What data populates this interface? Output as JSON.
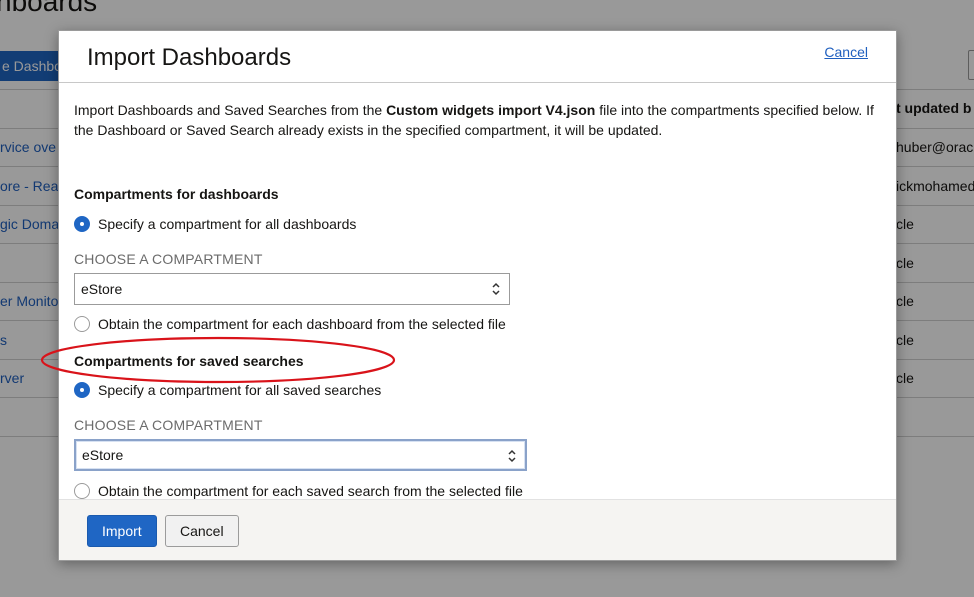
{
  "background": {
    "title_fragment": "hboards",
    "pill_fragment": "e Dashboards",
    "column_head_fragment": "t updated b",
    "left_links": [
      "rvice ove",
      "ore - Real",
      "gic Domai",
      "",
      "er Monito",
      "s",
      "rver"
    ],
    "right_cells": [
      "huber@oracl",
      "ickmohamed",
      "cle",
      "cle",
      "cle",
      "cle",
      "cle"
    ]
  },
  "dialog": {
    "title": "Import Dashboards",
    "cancel_link": "Cancel",
    "intro": {
      "before": "Import Dashboards and Saved Searches from the ",
      "file_name": "Custom widgets import V4.json",
      "after": " file into the compartments specified below. If the Dashboard or Saved Search already exists in the specified compartment, it will be updated."
    },
    "dashboards_section": {
      "heading": "Compartments for dashboards",
      "option_all": "Specify a compartment for all dashboards",
      "option_all_selected": true,
      "choose_label": "CHOOSE A COMPARTMENT",
      "selected_value": "eStore",
      "option_file": "Obtain the compartment for each dashboard from the selected file"
    },
    "searches_section": {
      "heading": "Compartments for saved searches",
      "option_all": "Specify a compartment for all saved searches",
      "option_all_selected": true,
      "choose_label": "CHOOSE A COMPARTMENT",
      "selected_value": "eStore",
      "option_file": "Obtain the compartment for each saved search from the selected file"
    },
    "footer": {
      "import_label": "Import",
      "cancel_label": "Cancel"
    }
  },
  "colors": {
    "accent": "#1f66c4",
    "link": "#1f5fbf",
    "annotation": "#d9131a"
  }
}
